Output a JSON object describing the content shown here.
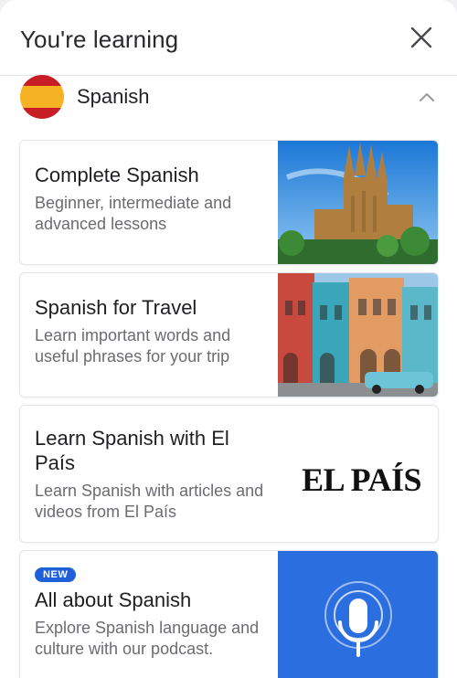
{
  "header": {
    "title": "You're learning"
  },
  "language": {
    "name": "Spanish",
    "flag_colors": {
      "red": "#c61e24",
      "yellow": "#f5b323"
    }
  },
  "courses": [
    {
      "title": "Complete Spanish",
      "description": "Beginner, intermediate and advanced lessons",
      "image": "sagrada-familia-photo"
    },
    {
      "title": "Spanish for Travel",
      "description": "Learn important words and useful phrases for your trip",
      "image": "colorful-street-photo"
    },
    {
      "title": "Learn Spanish with El País",
      "description": "Learn Spanish with articles and videos from El País",
      "logo": "EL PAÍS"
    },
    {
      "badge": "NEW",
      "title": "All about Spanish",
      "description": "Explore Spanish language and culture with our podcast.",
      "image": "podcast-microphone-icon"
    }
  ],
  "colors": {
    "accent": "#1f5fd8",
    "podcast_bg": "#2a6ee0"
  }
}
